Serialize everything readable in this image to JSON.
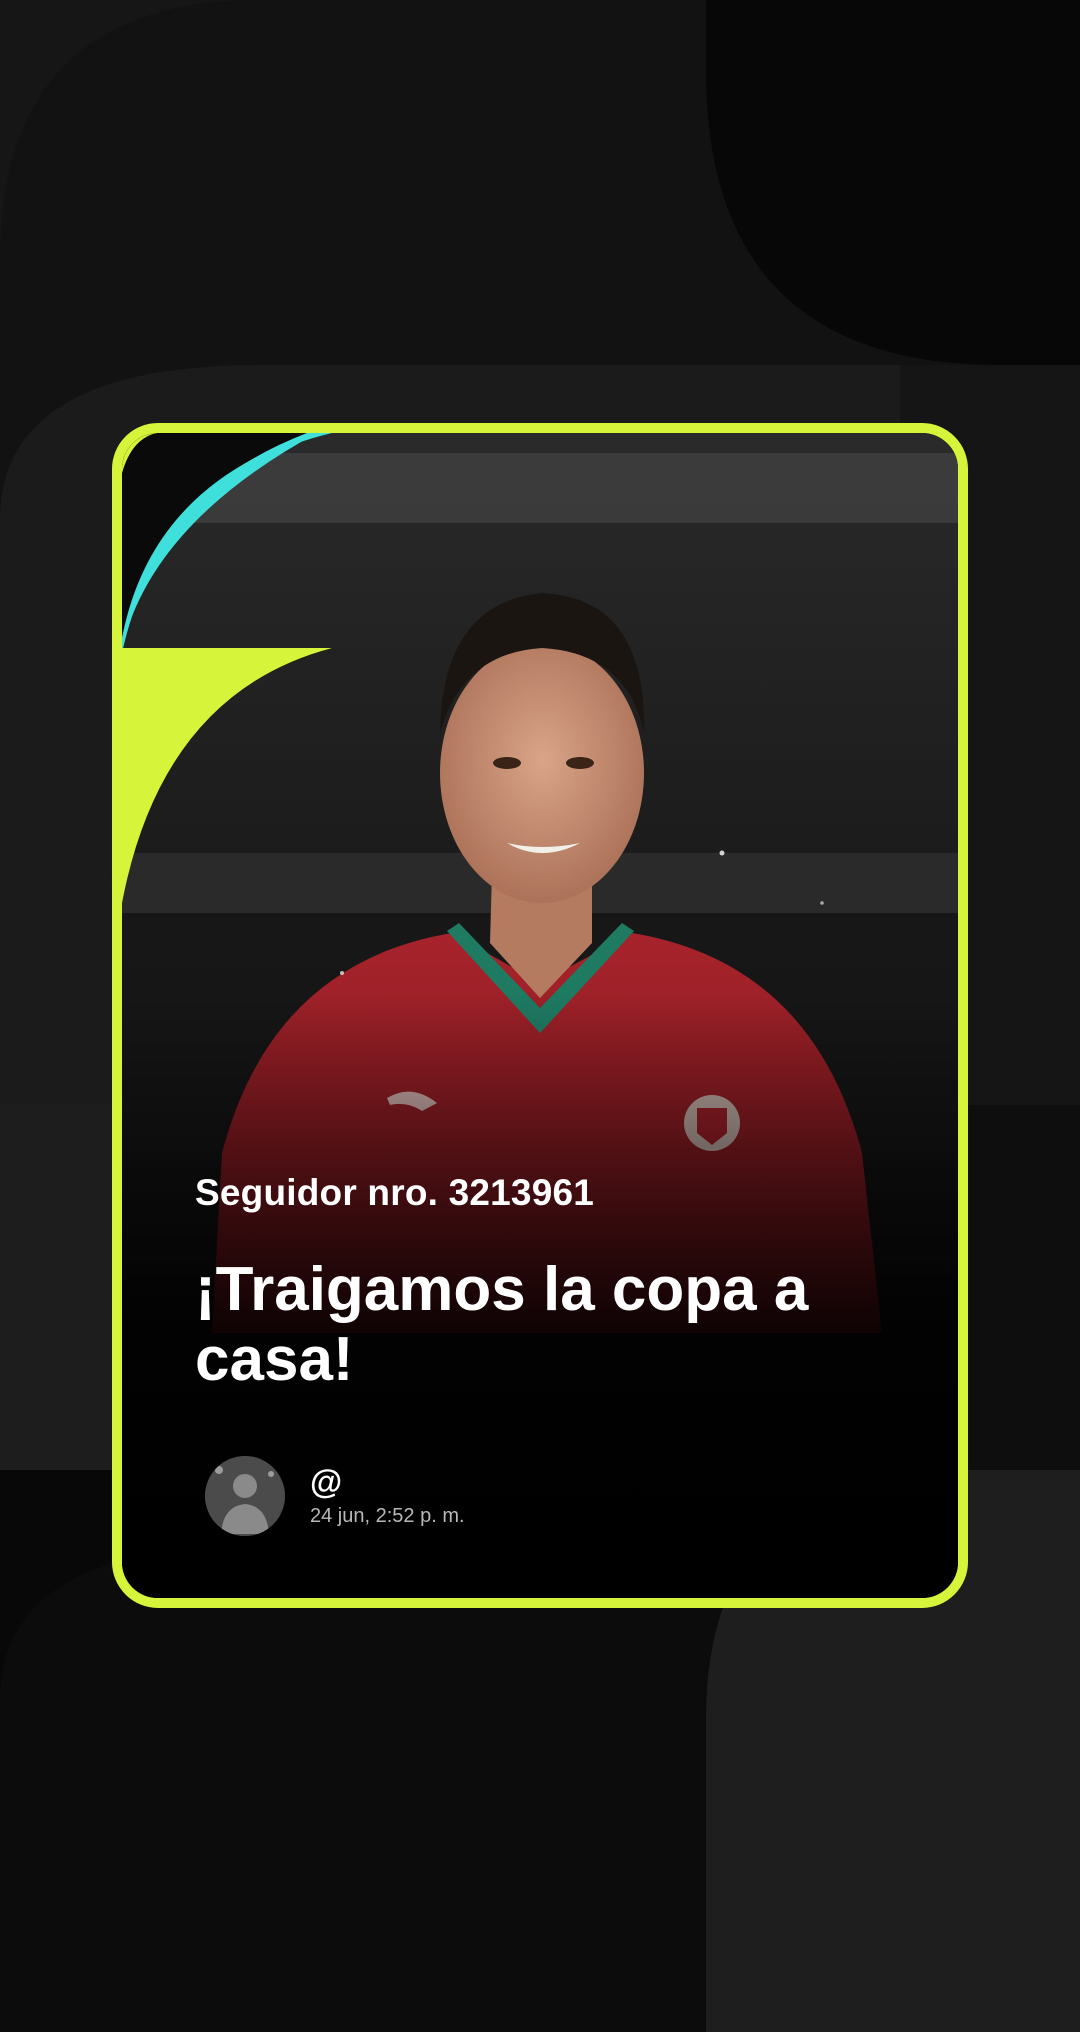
{
  "card": {
    "fan_number": "Seguidor nro. 3213961",
    "headline": "¡Traigamos la copa a casa!",
    "user_handle": "@",
    "timestamp": "24 jun, 2:52 p. m."
  },
  "colors": {
    "accent_lime": "#d6f53a",
    "accent_cyan": "#3fe0dc",
    "background": "#161616",
    "card_background": "#0a0a0a",
    "jersey_red": "#9a1e26"
  },
  "icons": {
    "avatar": "user-avatar-photo",
    "crest": "portugal-crest",
    "brand": "puma-logo"
  }
}
